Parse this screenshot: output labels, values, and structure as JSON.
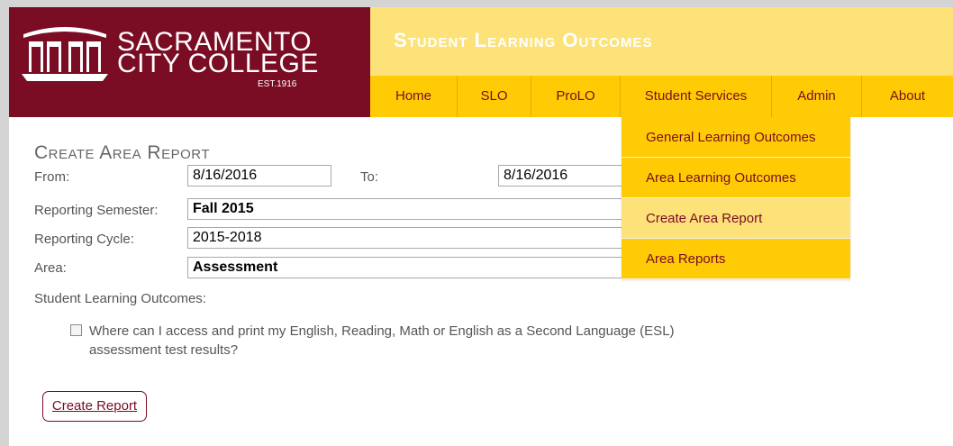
{
  "header": {
    "logo_line1": "SACRAMENTO",
    "logo_line2": "CITY COLLEGE",
    "logo_est": "EST.1916",
    "banner_title": "Student Learning Outcomes"
  },
  "nav": {
    "items": [
      {
        "label": "Home"
      },
      {
        "label": "SLO"
      },
      {
        "label": "ProLO"
      },
      {
        "label": "Student Services"
      },
      {
        "label": "Admin"
      },
      {
        "label": "About"
      }
    ]
  },
  "dropdown": {
    "items": [
      {
        "label": "General Learning Outcomes"
      },
      {
        "label": "Area Learning Outcomes"
      },
      {
        "label": "Create Area Report"
      },
      {
        "label": "Area Reports"
      }
    ]
  },
  "form": {
    "title": "Create Area Report",
    "from_label": "From:",
    "from_value": "8/16/2016",
    "to_label": "To:",
    "to_value": "8/16/2016",
    "semester_label": "Reporting Semester:",
    "semester_value": "Fall 2015",
    "cycle_label": "Reporting Cycle:",
    "cycle_value": "2015-2018",
    "area_label": "Area:",
    "area_value": "Assessment",
    "slo_label": "Student Learning Outcomes:",
    "slo_item": "Where can I access and print my English, Reading, Math or English as a Second Language (ESL) assessment test results?",
    "slo_checked": false,
    "button_label": "Create Report"
  },
  "colors": {
    "maroon": "#7a0c24",
    "gold": "#ffcb05",
    "light_gold": "#fde27a"
  }
}
